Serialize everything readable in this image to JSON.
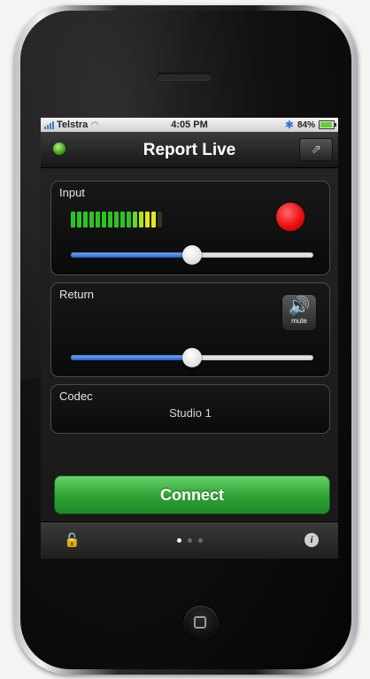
{
  "status_bar": {
    "carrier": "Telstra",
    "time": "4:05 PM",
    "battery": "84%",
    "battery_level": 0.84,
    "signal_bars": 4
  },
  "navbar": {
    "title": "Report Live",
    "status_color": "#3ea418"
  },
  "input_panel": {
    "label": "Input",
    "meter": {
      "segments": 15,
      "active": 14,
      "colors": [
        "#2fc224",
        "#2fc224",
        "#2fc224",
        "#2fc224",
        "#2fc224",
        "#2fc224",
        "#2fc224",
        "#2fc224",
        "#2fc224",
        "#2fc224",
        "#6fd61f",
        "#b4e21a",
        "#dfe818",
        "#e6e81a",
        "#e6e81a"
      ]
    },
    "record_color": "#ee0e0e",
    "volume_level": 0.5
  },
  "return_panel": {
    "label": "Return",
    "mute_label": "mute",
    "volume_level": 0.5
  },
  "codec_panel": {
    "label": "Codec",
    "value": "Studio 1"
  },
  "connect_label": "Connect",
  "connect_color": "#2ea033",
  "pager": {
    "pages": 3,
    "current": 0
  },
  "slider_fill_color": "#2a6fe0"
}
